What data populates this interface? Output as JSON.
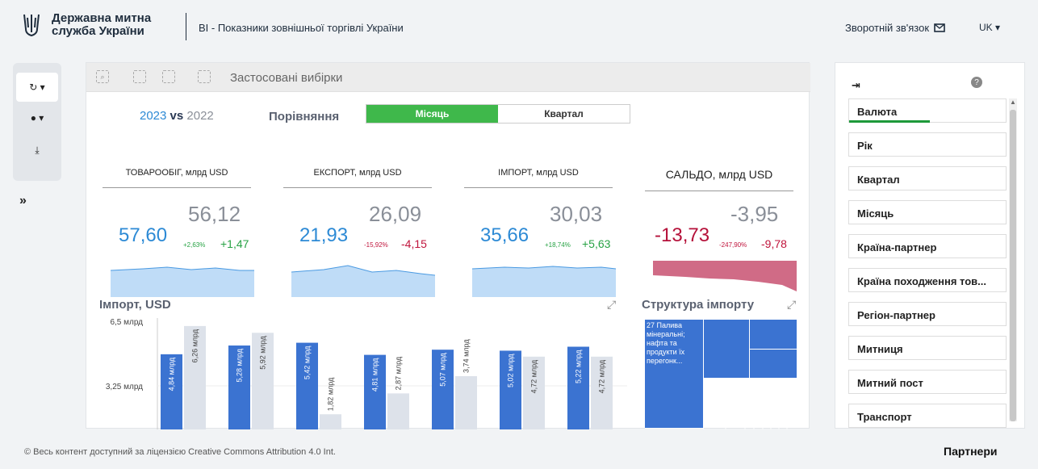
{
  "header": {
    "org_name": "Державна митна служба України",
    "app_title": "BI - Показники зовнішньої торгівлі України",
    "feedback": "Зворотній зв'язок",
    "lang": "UK"
  },
  "toolbar": {
    "selections_label": "Застосовані вибірки"
  },
  "compare": {
    "year_current": "2023",
    "vs": "vs",
    "year_prev": "2022",
    "label": "Порівняння",
    "options": [
      "Місяць",
      "Квартал"
    ],
    "selected": "Місяць"
  },
  "kpis": [
    {
      "title": "ТОВАРООБІГ, млрд USD",
      "current": "57,60",
      "previous": "56,12",
      "pct": "+2,63%",
      "delta": "+1,47",
      "trend": "up"
    },
    {
      "title": "ЕКСПОРТ, млрд USD",
      "current": "21,93",
      "previous": "26,09",
      "pct": "-15,92%",
      "delta": "-4,15",
      "trend": "down"
    },
    {
      "title": "ІМПОРТ, млрд USD",
      "current": "35,66",
      "previous": "30,03",
      "pct": "+18,74%",
      "delta": "+5,63",
      "trend": "up"
    },
    {
      "title": "САЛЬДО, млрд USD",
      "current": "-13,73",
      "previous": "-3,95",
      "pct": "-247,90%",
      "delta": "-9,78",
      "trend": "down"
    }
  ],
  "import_chart": {
    "title": "Імпорт, USD",
    "y_ticks": [
      "6,5 млрд",
      "3,25 млрд"
    ],
    "colors": {
      "current": "#3b73d1",
      "previous": "#dde2ea"
    }
  },
  "chart_data": {
    "type": "bar",
    "title": "Імпорт, USD",
    "ylim": [
      0,
      6.5
    ],
    "yunit": "млрд",
    "series": [
      {
        "name": "2023",
        "values": [
          4.84,
          5.28,
          5.42,
          4.81,
          5.07,
          5.02,
          5.22
        ],
        "labels": [
          "4,84 млрд",
          "5,28 млрд",
          "5,42 млрд",
          "4,81 млрд",
          "5,07 млрд",
          "5,02 млрд",
          "5,22 млрд"
        ]
      },
      {
        "name": "2022",
        "values": [
          6.26,
          5.92,
          1.82,
          2.87,
          3.74,
          4.72,
          4.72
        ],
        "labels": [
          "6,26 млрд",
          "5,92 млрд",
          "1,82 млрд",
          "2,87 млрд",
          "3,74 млрд",
          "4,72 млрд",
          "4,72 млрд"
        ]
      }
    ]
  },
  "structure": {
    "title": "Структура імпорту",
    "top_cell": "27 Палива мінеральні; нафта та продукти їх перегонк...",
    "color": "#3b73d1"
  },
  "filters": [
    "Валюта",
    "Рік",
    "Квартал",
    "Місяць",
    "Країна-партнер",
    "Країна походження тов...",
    "Регіон-партнер",
    "Митниця",
    "Митний пост",
    "Транспорт"
  ],
  "footer": {
    "license": "© Весь контент доступний за ліцензією Creative Commons Attribution 4.0 Int.",
    "partners": "Партнери"
  }
}
